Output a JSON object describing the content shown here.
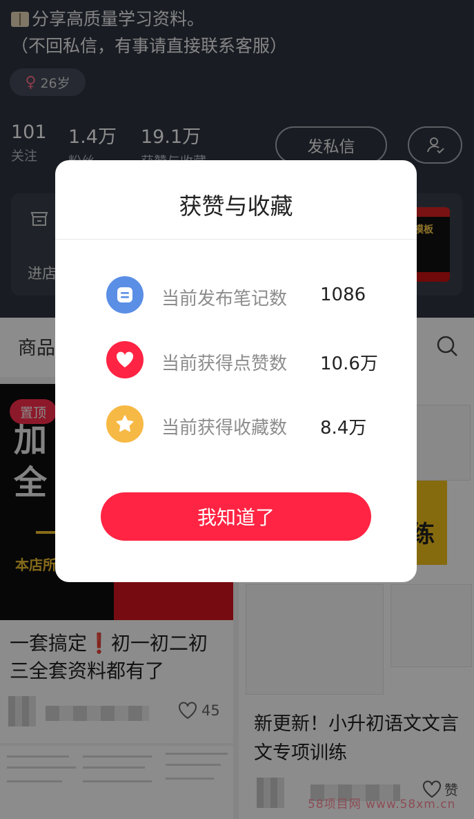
{
  "profile": {
    "bio_line1": "分享高质量学习资料。",
    "bio_line2": "（不回私信，有事请直接联系客服）",
    "age": "26岁",
    "stats": [
      {
        "num": "101",
        "label": "关注"
      },
      {
        "num": "1.4万",
        "label": "粉丝"
      },
      {
        "num": "19.1万",
        "label": "获赞与收藏"
      }
    ],
    "message_btn": "发私信",
    "shop_label": "进店",
    "thumb_text": "题模板"
  },
  "feed": {
    "tab_goods": "商品",
    "card1": {
      "pin": "置顶",
      "image_text_big": "加\n全",
      "image_text_yellow": "本店所",
      "title": "一套搞定❗️初一初二初三全套资料都有了",
      "likes": "45"
    },
    "card2": {
      "image_text": "练",
      "title": "新更新！小升初语文文言文专项训练",
      "like_label": "赞"
    },
    "watermark": "58项目网 www.58xm.cn"
  },
  "modal": {
    "title": "获赞与收藏",
    "rows": [
      {
        "label": "当前发布笔记数",
        "value": "1086",
        "icon": "note-icon",
        "color": "#5b8fe6"
      },
      {
        "label": "当前获得点赞数",
        "value": "10.6万",
        "icon": "heart-icon",
        "color": "#ff2443"
      },
      {
        "label": "当前获得收藏数",
        "value": "8.4万",
        "icon": "star-icon",
        "color": "#f7b945"
      }
    ],
    "confirm_button": "我知道了"
  }
}
